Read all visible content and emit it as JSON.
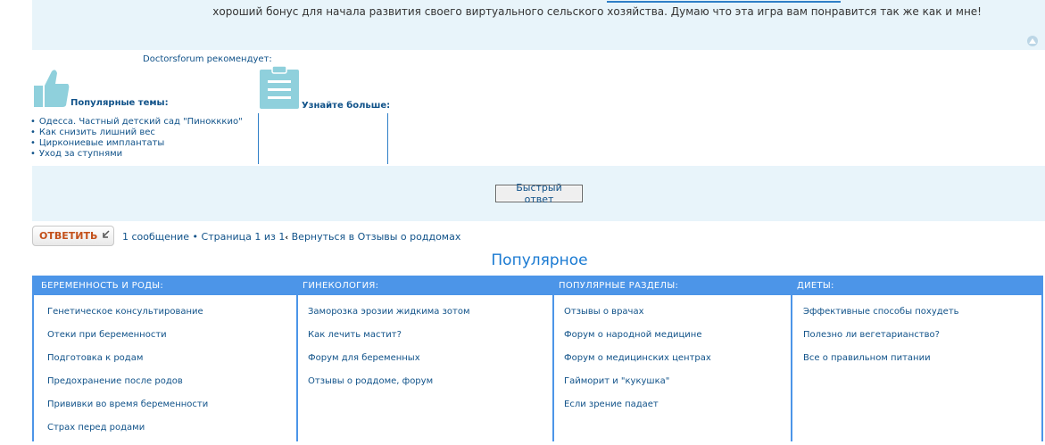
{
  "post": {
    "text": "хороший бонус для начала развития своего виртуального сельского хозяйства. Думаю что эта игра вам понравится так же как и мне!"
  },
  "recommends": {
    "title": "Doctorsforum рекомендует:",
    "popular_heading": "Популярные темы:",
    "learn_heading": "Узнайте больше:",
    "popular_topics": [
      "Одесса. Частный детский сад \"Пинокккио\"",
      "Как снизить лишний вес",
      "Циркониевые имплантаты",
      "Уход за ступнями"
    ]
  },
  "quick_reply": {
    "label": "Быстрый ответ"
  },
  "action_bar": {
    "reply_label": "ОТВЕТИТЬ",
    "message_count": "1 сообщение",
    "bullet": "•",
    "page_info": "Страница 1 из 1",
    "back_link": "Вернуться в Отзывы о роддомах"
  },
  "popular": {
    "title": "Популярное",
    "categories": [
      {
        "name": "БЕРЕМЕННОСТЬ И РОДЫ:",
        "links": [
          "Генетическое консультирование",
          "Отеки при беременности",
          "Подготовка к родам",
          "Предохранение после родов",
          "Прививки во время беременности",
          "Страх перед родами"
        ]
      },
      {
        "name": "ГИНЕКОЛОГИЯ:",
        "links": [
          "Заморозка эрозии жидкима зотом",
          "Как лечить мастит?",
          "Форум для беременных",
          "Отзывы о роддоме, форум"
        ]
      },
      {
        "name": "ПОПУЛЯРНЫЕ РАЗДЕЛЫ:",
        "links": [
          "Отзывы о врачах",
          "Форум о народной медицине",
          "Форум о медицинских центрах",
          "Гайморит и \"кукушка\"",
          "Если зрение падает"
        ]
      },
      {
        "name": "ДИЕТЫ:",
        "links": [
          "Эффективные способы похудеть",
          "Полезно ли вегетарианство?",
          "Все о правильном питании"
        ]
      }
    ]
  },
  "colors": {
    "link": "#105289",
    "panel": "#4c95e8",
    "box_bg": "#e8f4fa",
    "reply": "#c3501a"
  }
}
